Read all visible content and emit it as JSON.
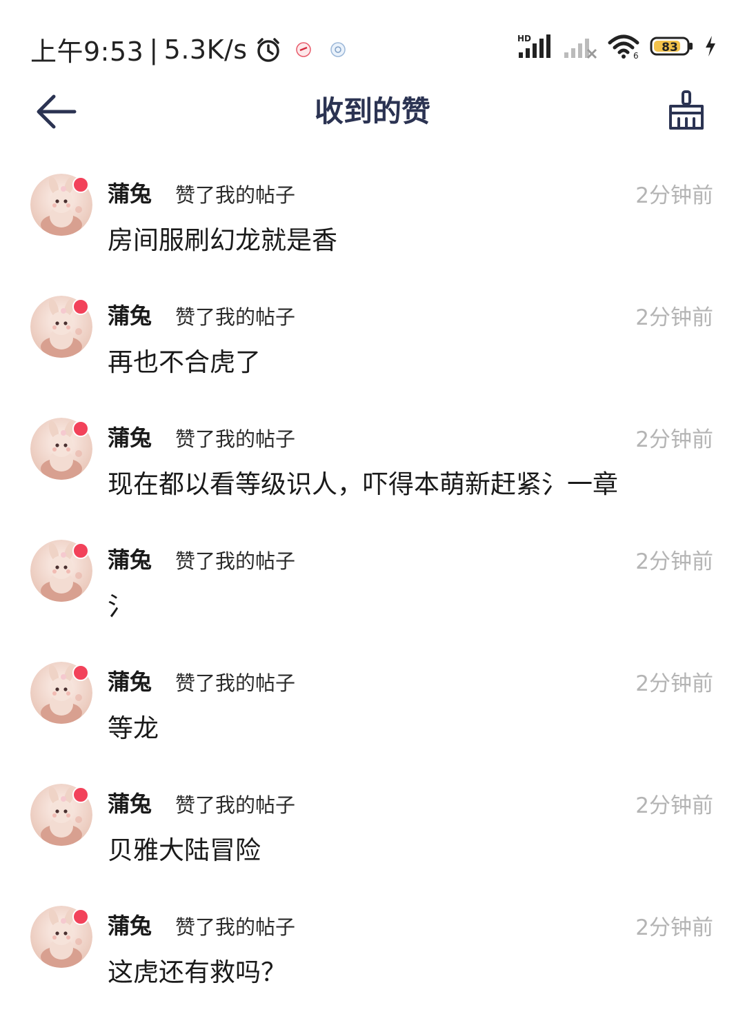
{
  "status_bar": {
    "time": "上午9:53",
    "net_speed": "5.3K/s",
    "signal_label": "HD",
    "battery_level": "83",
    "icons": [
      "alarm-icon",
      "notification-icon",
      "notification-icon",
      "signal-icon",
      "signal-icon",
      "wifi-icon",
      "battery-icon",
      "charging-icon"
    ]
  },
  "header": {
    "title": "收到的赞",
    "back_icon": "arrow-left-icon",
    "clear_icon": "broom-icon"
  },
  "colors": {
    "title": "#2b3352",
    "unread_dot": "#f2425a",
    "time_text": "#b4b4b4"
  },
  "likes": [
    {
      "user": "蒲兔",
      "action": "赞了我的帖子",
      "time": "2分钟前",
      "content": "房间服刷幻龙就是香",
      "unread": true
    },
    {
      "user": "蒲兔",
      "action": "赞了我的帖子",
      "time": "2分钟前",
      "content": "再也不合虎了",
      "unread": true
    },
    {
      "user": "蒲兔",
      "action": "赞了我的帖子",
      "time": "2分钟前",
      "content": "现在都以看等级识人，吓得本萌新赶紧氵一章",
      "unread": true
    },
    {
      "user": "蒲兔",
      "action": "赞了我的帖子",
      "time": "2分钟前",
      "content": "氵",
      "unread": true
    },
    {
      "user": "蒲兔",
      "action": "赞了我的帖子",
      "time": "2分钟前",
      "content": "等龙",
      "unread": true
    },
    {
      "user": "蒲兔",
      "action": "赞了我的帖子",
      "time": "2分钟前",
      "content": "贝雅大陆冒险",
      "unread": true
    },
    {
      "user": "蒲兔",
      "action": "赞了我的帖子",
      "time": "2分钟前",
      "content": "这虎还有救吗？",
      "unread": true
    }
  ]
}
